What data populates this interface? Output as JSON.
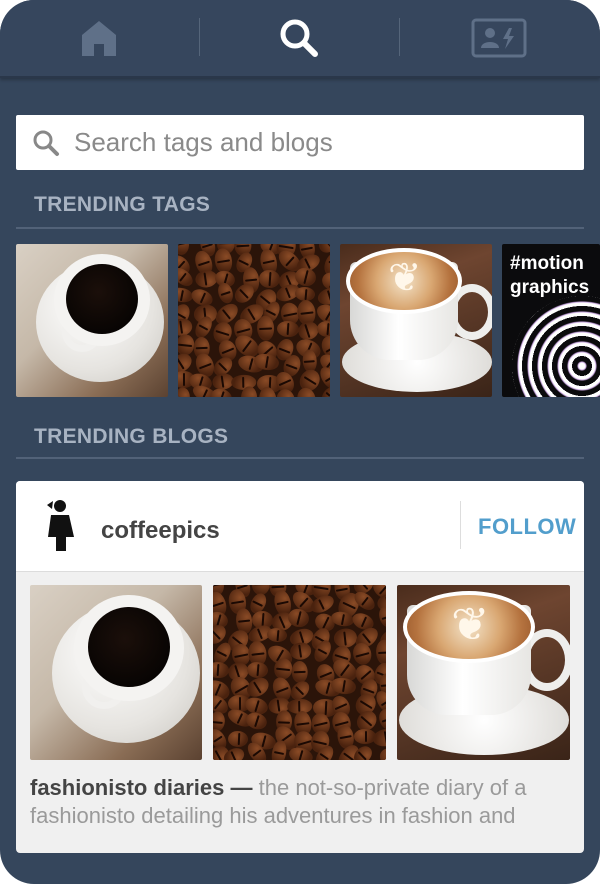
{
  "nav": {
    "tabs": [
      {
        "name": "home",
        "icon": "home-icon"
      },
      {
        "name": "search",
        "icon": "search-icon",
        "active": true
      },
      {
        "name": "account",
        "icon": "account-card-icon"
      }
    ]
  },
  "search": {
    "placeholder": "Search tags and blogs",
    "value": ""
  },
  "trending_tags": {
    "title": "TRENDING TAGS",
    "items": [
      {
        "image": "black coffee cup"
      },
      {
        "image": "coffee beans"
      },
      {
        "image": "latte art cup"
      },
      {
        "label": "#motion graphics",
        "line1": "#motion",
        "line2": "graphics"
      }
    ]
  },
  "trending_blogs": {
    "title": "TRENDING BLOGS",
    "blog": {
      "name": "coffeepics",
      "follow_label": "FOLLOW",
      "description_title": "fashionisto diaries",
      "description_sep": "—",
      "description": "the not-so-private diary of a fashionisto detailing his adventures in fashion and"
    }
  },
  "colors": {
    "background": "#35465c",
    "accent": "#529ecc",
    "section_title": "#a8b3c2"
  }
}
